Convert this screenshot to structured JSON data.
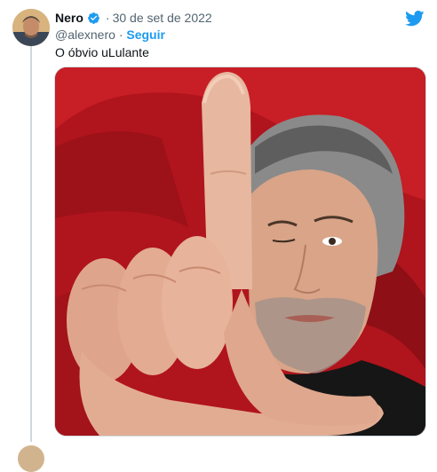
{
  "tweet": {
    "author_name": "Nero",
    "separator": "·",
    "date": "30 de set de 2022",
    "handle": "@alexnero",
    "dot": "·",
    "follow_label": "Seguir",
    "text": "O óbvio uLulante",
    "verified_icon": "verified-badge-icon",
    "logo_icon": "twitter-bird-icon"
  },
  "colors": {
    "accent": "#1d9bf0",
    "text_primary": "#0f1419",
    "text_secondary": "#536471",
    "photo_background": "#b3151d"
  }
}
